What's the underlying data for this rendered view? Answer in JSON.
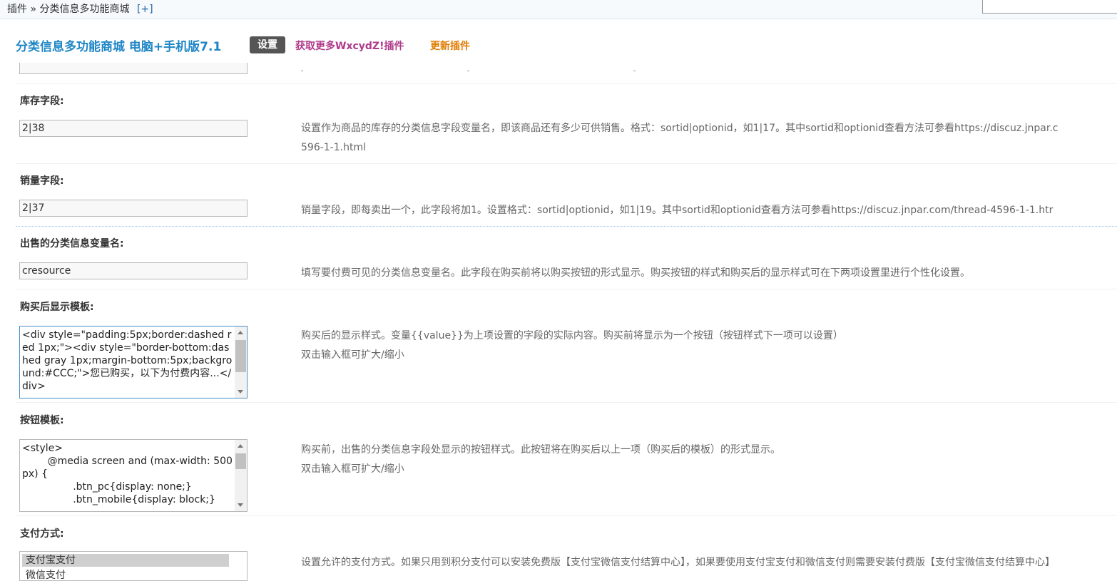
{
  "breadcrumb": {
    "root": "插件",
    "sep": "»",
    "current": "分类信息多功能商城",
    "plus": "[+]"
  },
  "header": {
    "title": "分类信息多功能商城 电脑+手机版7.1",
    "settings_button": "设置",
    "more_link": "获取更多WxcydZ!插件",
    "update_link": "更新插件"
  },
  "fields": {
    "stock": {
      "label": "库存字段:",
      "value": "2|38",
      "desc_line1": "设置作为商品的库存的分类信息字段变量名，即该商品还有多少可供销售。格式：sortid|optionid，如1|17。其中sortid和optionid查看方法可参看https://discuz.jnpar.c",
      "desc_line2": "596-1-1.html"
    },
    "sales": {
      "label": "销量字段:",
      "value": "2|37",
      "desc": "销量字段，即每卖出一个，此字段将加1。设置格式：sortid|optionid，如1|19。其中sortid和optionid查看方法可参看https://discuz.jnpar.com/thread-4596-1-1.htr"
    },
    "sale_var": {
      "label": "出售的分类信息变量名:",
      "value": "cresource",
      "desc": "填写要付费可见的分类信息变量名。此字段在购买前将以购买按钮的形式显示。购买按钮的样式和购买后的显示样式可在下两项设置里进行个性化设置。"
    },
    "after_tpl": {
      "label": "购买后显示模板:",
      "value": "<div style=\"padding:5px;border:dashed red 1px;\"><div style=\"border-bottom:dashed gray 1px;margin-bottom:5px;background:#CCC;\">您已购买，以下为付费内容...</div>",
      "desc": "购买后的显示样式。变量{{value}}为上项设置的字段的实际内容。购买前将显示为一个按钮（按钮样式下一项可以设置）",
      "hint": "双击输入框可扩大/缩小"
    },
    "button_tpl": {
      "label": "按钮模板:",
      "value": "<style>\n        @media screen and (max-width: 500px) {\n                .btn_pc{display: none;}\n                .btn_mobile{display: block;}",
      "desc": "购买前，出售的分类信息字段处显示的按钮样式。此按钮将在购买后以上一项（购买后的模板）的形式显示。",
      "hint": "双击输入框可扩大/缩小"
    },
    "payment": {
      "label": "支付方式:",
      "options": [
        "支付宝支付",
        "微信支付"
      ],
      "desc": "设置允许的支付方式。如果只用到积分支付可以安装免费版【支付宝微信支付结算中心】，如果要使用支付宝支付和微信支付则需要安装付费版【支付宝微信支付结算中心】"
    }
  },
  "colors": {
    "title": "#1e86c6",
    "button_bg": "#555555",
    "link_more": "#b03a8a",
    "link_update": "#e07b00"
  }
}
